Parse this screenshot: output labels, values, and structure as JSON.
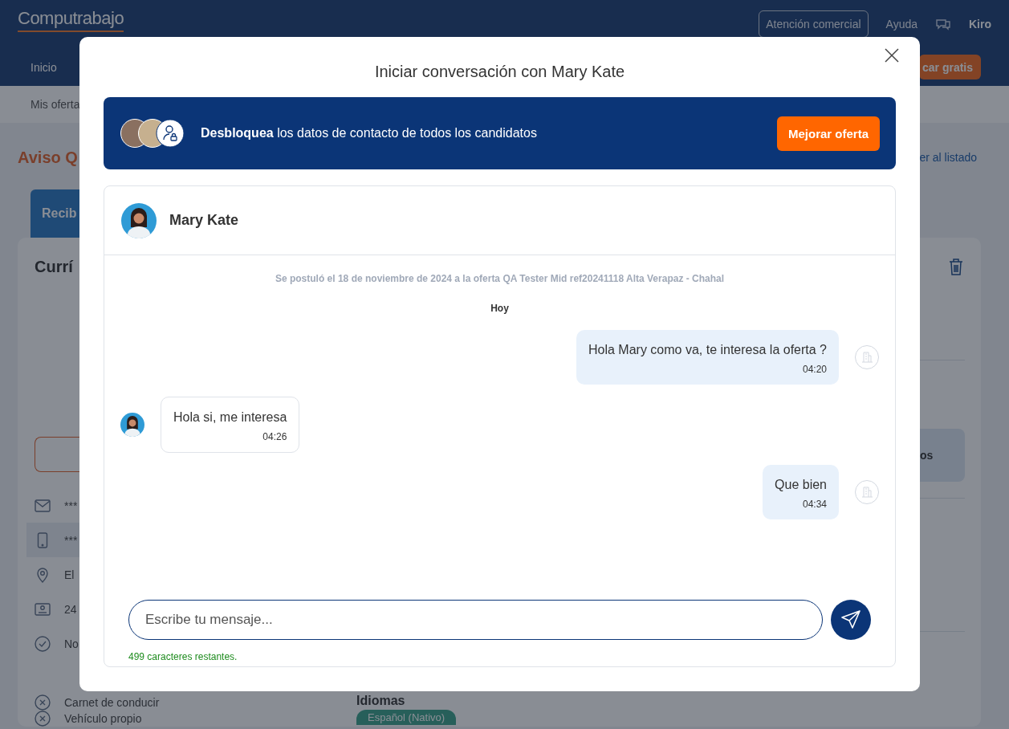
{
  "header": {
    "logo": "Computrabajo",
    "links": [
      {
        "kind": "outlined",
        "label": "Atención comercial"
      },
      {
        "kind": "plain",
        "label": "Ayuda"
      }
    ],
    "user": "Kiro"
  },
  "nav": {
    "items": [
      {
        "label": "Inicio"
      }
    ],
    "publish_button": "car gratis"
  },
  "subnav": {
    "item": "Mis oferta"
  },
  "page": {
    "title": "Aviso Q",
    "back_link": "er al listado",
    "tab": "Recib",
    "card_title": "Currí",
    "details": [
      {
        "kind": "mail",
        "text": "***",
        "selected": false
      },
      {
        "kind": "phone",
        "text": "***",
        "selected": true
      },
      {
        "kind": "pin",
        "text": "El",
        "selected": false
      },
      {
        "kind": "id",
        "text": "24",
        "selected": false
      },
      {
        "kind": "check",
        "text": "No",
        "selected": false
      },
      {
        "kind": "cross",
        "text": "Carnet de conducir",
        "selected": false
      },
      {
        "kind": "cross",
        "text": "Vehículo propio",
        "selected": false
      }
    ],
    "side_box": "os",
    "languages_title": "Idiomas",
    "language_tag": "Español (Nativo)"
  },
  "modal": {
    "title": "Iniciar conversación con Mary Kate",
    "banner": {
      "text": "**Desbloquea** los datos de contacto de todos los candidatos",
      "button": "Mejorar oferta"
    },
    "chat": {
      "contact": "Mary Kate",
      "note": "Se postuló el 18 de noviembre de 2024 a la oferta QA Tester Mid ref20241118 Alta Verapaz - Chahal",
      "day": "Hoy",
      "messages": [
        {
          "kind": "sent",
          "text": "Hola Mary como va, te interesa la oferta ?",
          "time": "04:20"
        },
        {
          "kind": "received",
          "text": "Hola si, me interesa",
          "time": "04:26"
        },
        {
          "kind": "sent",
          "text": "Que bien",
          "time": "04:34"
        }
      ],
      "input": {
        "placeholder": "Escribe tu mensaje..."
      },
      "counter": "499 caracteres restantes."
    }
  }
}
